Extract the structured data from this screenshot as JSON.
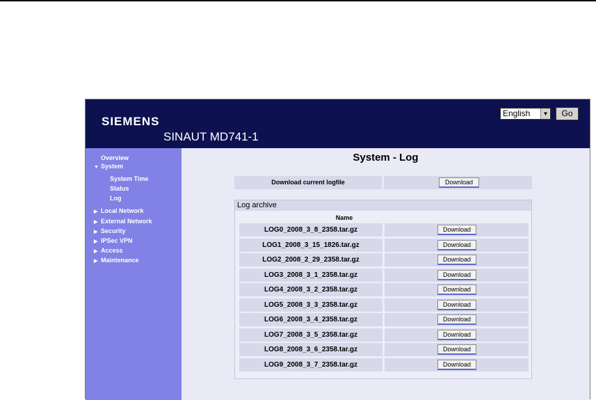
{
  "header": {
    "logo": "SIEMENS",
    "product": "SINAUT MD741-1",
    "language_selected": "English",
    "go_label": "Go"
  },
  "sidebar": {
    "items": [
      {
        "label": "Overview",
        "level": 0,
        "marker": ""
      },
      {
        "label": "System",
        "level": 0,
        "marker": "▼"
      },
      {
        "label": "System Time",
        "level": 1,
        "marker": ""
      },
      {
        "label": "Status",
        "level": 1,
        "marker": ""
      },
      {
        "label": "Log",
        "level": 1,
        "marker": ""
      },
      {
        "label": "Local Network",
        "level": 0,
        "marker": "▶"
      },
      {
        "label": "External Network",
        "level": 0,
        "marker": "▶"
      },
      {
        "label": "Security",
        "level": 0,
        "marker": "▶"
      },
      {
        "label": "IPSec VPN",
        "level": 0,
        "marker": "▶"
      },
      {
        "label": "Access",
        "level": 0,
        "marker": "▶"
      },
      {
        "label": "Maintenance",
        "level": 0,
        "marker": "▶"
      }
    ]
  },
  "main": {
    "title": "System - Log",
    "current_logfile_label": "Download current logfile",
    "download_label": "Download",
    "archive_title": "Log archive",
    "name_header": "Name",
    "archive_files": [
      "LOG0_2008_3_8_2358.tar.gz",
      "LOG1_2008_3_15_1826.tar.gz",
      "LOG2_2008_2_29_2358.tar.gz",
      "LOG3_2008_3_1_2358.tar.gz",
      "LOG4_2008_3_2_2358.tar.gz",
      "LOG5_2008_3_3_2358.tar.gz",
      "LOG6_2008_3_4_2358.tar.gz",
      "LOG7_2008_3_5_2358.tar.gz",
      "LOG8_2008_3_6_2358.tar.gz",
      "LOG9_2008_3_7_2358.tar.gz"
    ]
  }
}
